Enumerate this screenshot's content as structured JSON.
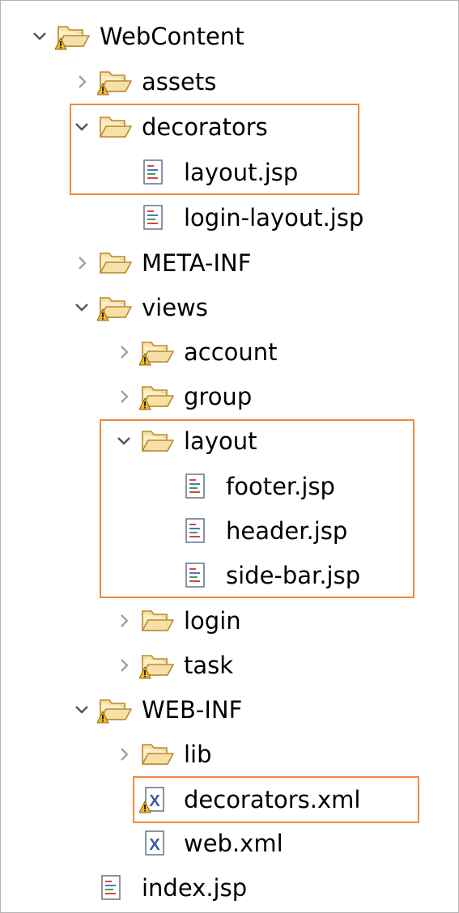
{
  "colors": {
    "highlight": "#f08a3c",
    "folder_fill": "#f6e0a7",
    "folder_stroke": "#b98a2e",
    "warning": "#f2b825",
    "jsp_accent": "#d64545",
    "xml_accent": "#3a5aa8",
    "frame": "#b4b4b4"
  },
  "tree": {
    "items": [
      {
        "label": "WebContent",
        "kind": "folder",
        "expanded": true,
        "warning": true,
        "icon": "folder-open-icon"
      },
      {
        "label": "assets",
        "kind": "folder",
        "expanded": false,
        "warning": true,
        "icon": "folder-open-icon"
      },
      {
        "label": "decorators",
        "kind": "folder",
        "expanded": true,
        "warning": false,
        "icon": "folder-open-icon"
      },
      {
        "label": "layout.jsp",
        "kind": "jsp",
        "warning": false,
        "icon": "jsp-file-icon"
      },
      {
        "label": "login-layout.jsp",
        "kind": "jsp",
        "warning": false,
        "icon": "jsp-file-icon"
      },
      {
        "label": "META-INF",
        "kind": "folder",
        "expanded": false,
        "warning": false,
        "icon": "folder-open-icon"
      },
      {
        "label": "views",
        "kind": "folder",
        "expanded": true,
        "warning": true,
        "icon": "folder-open-icon"
      },
      {
        "label": "account",
        "kind": "folder",
        "expanded": false,
        "warning": true,
        "icon": "folder-open-icon"
      },
      {
        "label": "group",
        "kind": "folder",
        "expanded": false,
        "warning": true,
        "icon": "folder-open-icon"
      },
      {
        "label": "layout",
        "kind": "folder",
        "expanded": true,
        "warning": false,
        "icon": "folder-open-icon"
      },
      {
        "label": "footer.jsp",
        "kind": "jsp",
        "warning": false,
        "icon": "jsp-file-icon"
      },
      {
        "label": "header.jsp",
        "kind": "jsp",
        "warning": false,
        "icon": "jsp-file-icon"
      },
      {
        "label": "side-bar.jsp",
        "kind": "jsp",
        "warning": false,
        "icon": "jsp-file-icon"
      },
      {
        "label": "login",
        "kind": "folder",
        "expanded": false,
        "warning": false,
        "icon": "folder-open-icon"
      },
      {
        "label": "task",
        "kind": "folder",
        "expanded": false,
        "warning": true,
        "icon": "folder-open-icon"
      },
      {
        "label": "WEB-INF",
        "kind": "folder",
        "expanded": true,
        "warning": true,
        "icon": "folder-open-icon"
      },
      {
        "label": "lib",
        "kind": "folder",
        "expanded": false,
        "warning": false,
        "icon": "folder-open-icon"
      },
      {
        "label": "decorators.xml",
        "kind": "xml",
        "warning": true,
        "icon": "xml-file-icon"
      },
      {
        "label": "web.xml",
        "kind": "xml",
        "warning": false,
        "icon": "xml-file-icon"
      },
      {
        "label": "index.jsp",
        "kind": "jsp",
        "warning": false,
        "icon": "jsp-file-icon"
      }
    ]
  }
}
